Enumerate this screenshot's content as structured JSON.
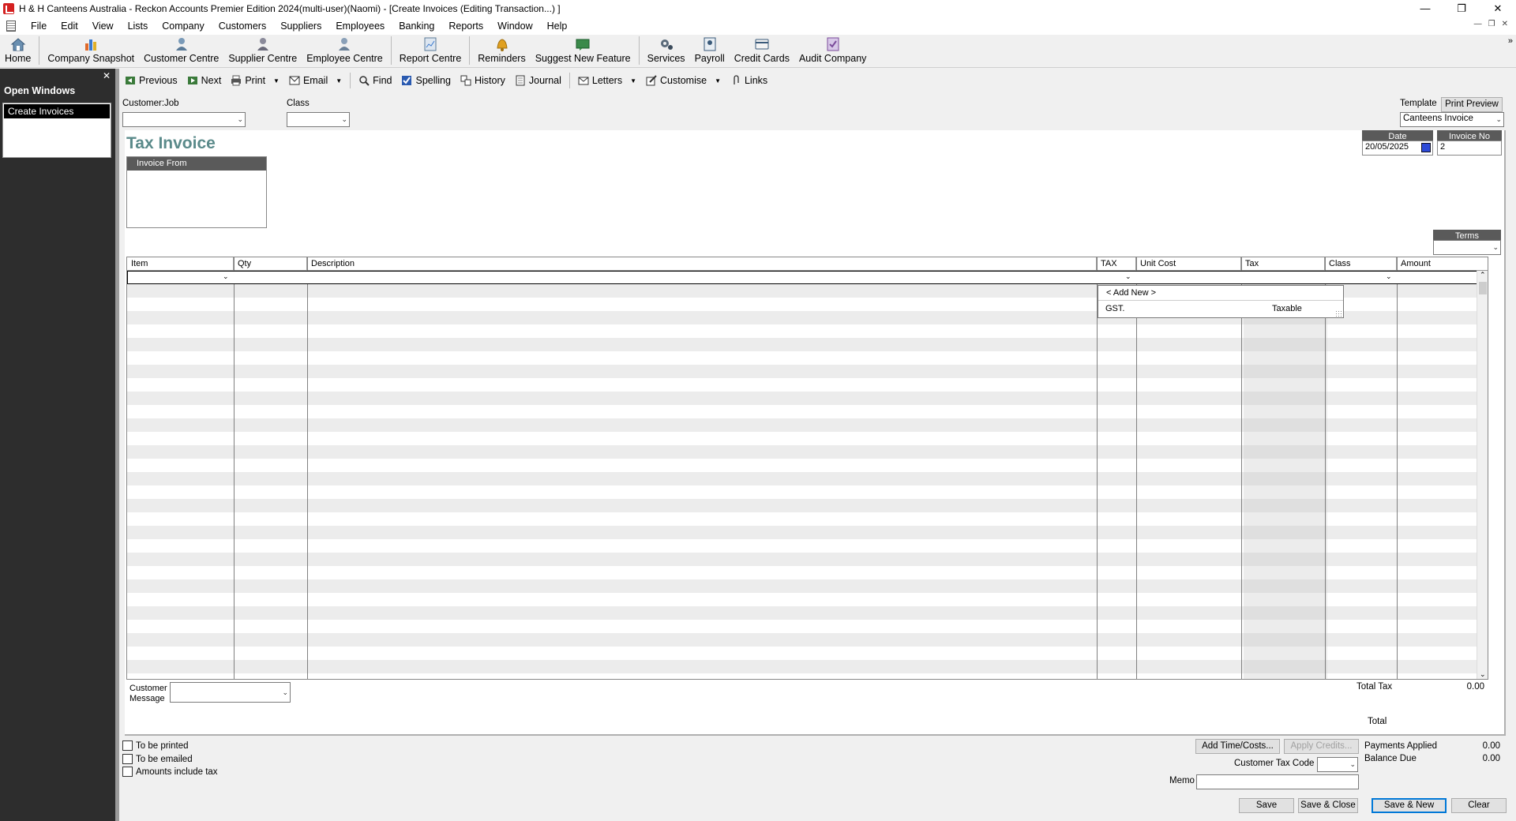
{
  "window": {
    "title": "H & H Canteens Australia - Reckon Accounts Premier Edition 2024(multi-user)(Naomi) - [Create Invoices (Editing Transaction...) ]"
  },
  "menu": [
    "File",
    "Edit",
    "View",
    "Lists",
    "Company",
    "Customers",
    "Suppliers",
    "Employees",
    "Banking",
    "Reports",
    "Window",
    "Help"
  ],
  "toolbar": {
    "home": "Home",
    "company_snapshot": "Company Snapshot",
    "customer_centre": "Customer Centre",
    "supplier_centre": "Supplier Centre",
    "employee_centre": "Employee Centre",
    "report_centre": "Report Centre",
    "reminders": "Reminders",
    "suggest": "Suggest New Feature",
    "services": "Services",
    "payroll": "Payroll",
    "credit_cards": "Credit Cards",
    "audit_company": "Audit Company"
  },
  "sidebar": {
    "title": "Open Windows",
    "items": [
      "Create Invoices"
    ]
  },
  "form_toolbar": {
    "previous": "Previous",
    "next": "Next",
    "print": "Print",
    "email": "Email",
    "find": "Find",
    "spelling": "Spelling",
    "history": "History",
    "journal": "Journal",
    "letters": "Letters",
    "customise": "Customise",
    "links": "Links"
  },
  "header": {
    "customer_job_label": "Customer:Job",
    "customer_job_value": "",
    "class_label": "Class",
    "class_value": "",
    "template_label": "Template",
    "print_preview": "Print Preview",
    "template_value": "Canteens Invoice"
  },
  "invoice": {
    "title": "Tax Invoice",
    "invoice_from_label": "Invoice From",
    "date_label": "Date",
    "date_value": "20/05/2025",
    "invoice_no_label": "Invoice No",
    "invoice_no_value": "2",
    "terms_label": "Terms",
    "terms_value": ""
  },
  "grid": {
    "columns": [
      "Item",
      "Qty",
      "Description",
      "TAX",
      "Unit Cost",
      "Tax",
      "Class",
      "Amount"
    ]
  },
  "tax_popup": {
    "add_new": "< Add New >",
    "code": "GST.",
    "desc": "Taxable"
  },
  "footer": {
    "customer_message_label_1": "Customer",
    "customer_message_label_2": "Message",
    "total_tax_label": "Total Tax",
    "total_tax_value": "0.00",
    "total_label": "Total"
  },
  "bottom": {
    "to_be_printed": "To be printed",
    "to_be_emailed": "To be emailed",
    "amounts_include_tax": "Amounts include tax",
    "add_time_costs": "Add Time/Costs...",
    "apply_credits": "Apply Credits...",
    "payments_applied_label": "Payments Applied",
    "payments_applied_value": "0.00",
    "balance_due_label": "Balance Due",
    "balance_due_value": "0.00",
    "customer_tax_code_label": "Customer Tax Code",
    "memo_label": "Memo",
    "save": "Save",
    "save_close": "Save & Close",
    "save_new": "Save & New",
    "clear": "Clear"
  }
}
